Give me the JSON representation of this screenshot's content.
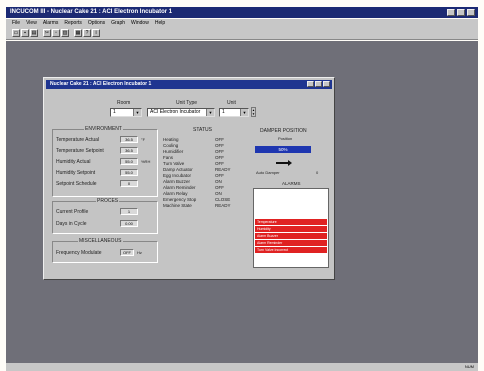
{
  "app": {
    "title": "INCUCOM III - Nuclear Cake 21 : ACI Electron Incubator 1",
    "menu": [
      "File",
      "View",
      "Alarms",
      "Reports",
      "Options",
      "Graph",
      "Window",
      "Help"
    ],
    "toolbar_icons": [
      "open-icon",
      "save-icon",
      "print-icon",
      "cut-icon",
      "copy-icon",
      "paste-icon",
      "graph-icon",
      "help-icon",
      "about-icon"
    ],
    "status_right": "NUM"
  },
  "dialog": {
    "title": "Nuclear Cake 21 : ACI Electron Incubator 1",
    "selectors": {
      "room_label": "Room",
      "room_value": "1",
      "unit_type_label": "Unit Type",
      "unit_type_value": "ACI Electron Incubator",
      "unit_label": "Unit",
      "unit_value": "1"
    },
    "environment": {
      "title": "ENVIRONMENT",
      "rows": [
        {
          "label": "Temperature Actual",
          "value": "36.5",
          "unit": "°F"
        },
        {
          "label": "Temperature Setpoint",
          "value": "36.5",
          "unit": ""
        },
        {
          "label": "Humidity Actual",
          "value": "55.0",
          "unit": "%RH"
        },
        {
          "label": "Humidity Setpoint",
          "value": "55.0",
          "unit": ""
        },
        {
          "label": "Setpoint Schedule",
          "value": "0",
          "unit": ""
        }
      ]
    },
    "proces": {
      "title": "PROCES",
      "rows": [
        {
          "label": "Current Profile",
          "value": "1"
        },
        {
          "label": "Days in Cycle",
          "value": "0.00"
        }
      ]
    },
    "miscellaneous": {
      "title": "MISCELLANEOUS",
      "rows": [
        {
          "label": "Frequency Modulate",
          "value": "OFF",
          "unit": "Hz"
        }
      ]
    },
    "status": {
      "title": "STATUS",
      "rows": [
        {
          "label": "Heating",
          "value": "OFF"
        },
        {
          "label": "Cooling",
          "value": "OFF"
        },
        {
          "label": "Humidifier",
          "value": "OFF"
        },
        {
          "label": "Fans",
          "value": "OFF"
        },
        {
          "label": "Turn Valve",
          "value": "OFF"
        },
        {
          "label": "Damp Actuator",
          "value": "READY"
        },
        {
          "label": "Egg Incubator",
          "value": "OFF"
        },
        {
          "label": "Alarm Buzzer",
          "value": "ON"
        },
        {
          "label": "Alarm Reminder",
          "value": "OFF"
        },
        {
          "label": "Alarm Relay",
          "value": "ON"
        },
        {
          "label": "Emergency Stop",
          "value": "CLOSE"
        },
        {
          "label": "Machine State",
          "value": "READY"
        }
      ]
    },
    "damper": {
      "title": "DAMPER POSITION",
      "status": "Position",
      "value": "50%",
      "value_pct": 50,
      "dial_label": "Auto Damper",
      "dial_value": "0"
    },
    "alarms": {
      "title": "ALARMS",
      "items": [
        {
          "text": "",
          "color": "#ffffff"
        },
        {
          "text": "",
          "color": "#ffffff"
        },
        {
          "text": "",
          "color": "#ffffff"
        },
        {
          "text": "",
          "color": "#ffffff"
        },
        {
          "text": "Temperature",
          "color": "#e02222"
        },
        {
          "text": "Humidity",
          "color": "#e02222"
        },
        {
          "text": "Alarm Buzzer",
          "color": "#e02222"
        },
        {
          "text": "Alarm Reminder",
          "color": "#e02222"
        },
        {
          "text": "Turn Valve Incorrect",
          "color": "#e02222"
        }
      ]
    }
  }
}
